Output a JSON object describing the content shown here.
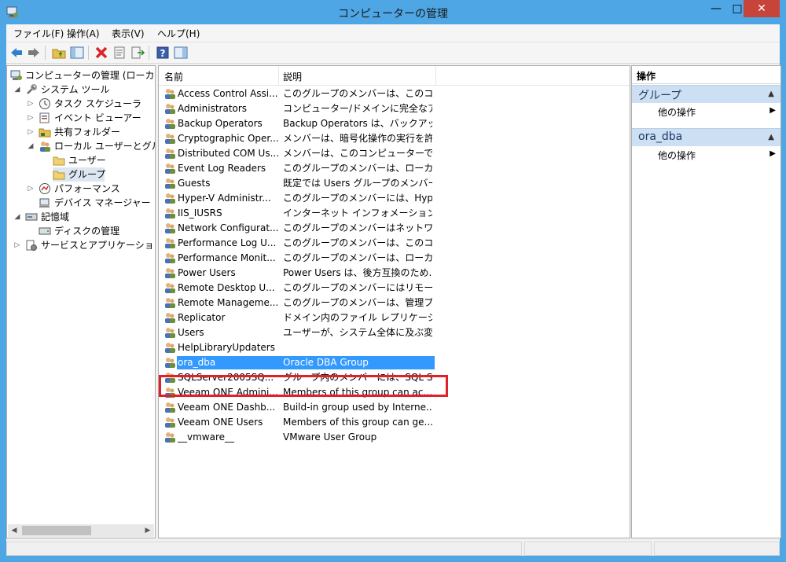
{
  "window": {
    "title": "コンピューターの管理",
    "min": "—",
    "max": "□",
    "close": "✕"
  },
  "menu": [
    "ファイル(F)",
    "操作(A)",
    "表示(V)",
    "ヘルプ(H)"
  ],
  "tree": {
    "items": [
      {
        "label": "コンピューターの管理 (ローカル)",
        "icon": "computer-management-icon"
      },
      {
        "label": "システム ツール",
        "icon": "tools-icon",
        "arrow": "◢"
      },
      {
        "label": "タスク スケジューラ",
        "icon": "clock-icon",
        "arrow": "▷"
      },
      {
        "label": "イベント ビューアー",
        "icon": "event-viewer-icon",
        "arrow": "▷"
      },
      {
        "label": "共有フォルダー",
        "icon": "shared-folder-icon",
        "arrow": "▷"
      },
      {
        "label": "ローカル ユーザーとグループ",
        "icon": "users-icon",
        "arrow": "◢"
      },
      {
        "label": "ユーザー",
        "icon": "folder-icon"
      },
      {
        "label": "グループ",
        "icon": "folder-icon"
      },
      {
        "label": "パフォーマンス",
        "icon": "performance-icon",
        "arrow": "▷"
      },
      {
        "label": "デバイス マネージャー",
        "icon": "device-manager-icon"
      },
      {
        "label": "記憶域",
        "icon": "storage-icon",
        "arrow": "◢"
      },
      {
        "label": "ディスクの管理",
        "icon": "disk-icon"
      },
      {
        "label": "サービスとアプリケーション",
        "icon": "services-icon",
        "arrow": "▷"
      }
    ]
  },
  "list": {
    "headers": {
      "name": "名前",
      "description": "説明"
    },
    "rows": [
      {
        "name": "Access Control Assi...",
        "description": "このグループのメンバーは、このコンピュ..."
      },
      {
        "name": "Administrators",
        "description": "コンピューター/ドメインに完全なアクセ..."
      },
      {
        "name": "Backup Operators",
        "description": "Backup Operators は、バックアップ..."
      },
      {
        "name": "Cryptographic Oper...",
        "description": "メンバーは、暗号化操作の実行を許..."
      },
      {
        "name": "Distributed COM Us...",
        "description": "メンバーは、このコンピューターで分散 ..."
      },
      {
        "name": "Event Log Readers",
        "description": "このグループのメンバーは、ローカル コ..."
      },
      {
        "name": "Guests",
        "description": "既定では Users グループのメンバー..."
      },
      {
        "name": "Hyper-V Administr...",
        "description": "このグループのメンバーには、Hyper-..."
      },
      {
        "name": "IIS_IUSRS",
        "description": "インターネット インフォメーション サービ..."
      },
      {
        "name": "Network Configurat...",
        "description": "このグループのメンバーはネットワーク..."
      },
      {
        "name": "Performance Log U...",
        "description": "このグループのメンバーは、このコンピュ..."
      },
      {
        "name": "Performance Monit...",
        "description": "このグループのメンバーは、ローカルやリ..."
      },
      {
        "name": "Power Users",
        "description": "Power Users は、後方互換のため..."
      },
      {
        "name": "Remote Desktop U...",
        "description": "このグループのメンバーにはリモートから..."
      },
      {
        "name": "Remote Manageme...",
        "description": "このグループのメンバーは、管理プロト..."
      },
      {
        "name": "Replicator",
        "description": "ドメイン内のファイル レプリケーションを..."
      },
      {
        "name": "Users",
        "description": "ユーザーが、システム全体に及ぶ変更..."
      },
      {
        "name": "HelpLibraryUpdaters",
        "description": ""
      },
      {
        "name": "ora_dba",
        "description": "Oracle DBA Group"
      },
      {
        "name": "SQLServer2005SQ...",
        "description": "グループ内のメンバーには、SQL Ser..."
      },
      {
        "name": "Veeam ONE Admini...",
        "description": "Members of this group can ac..."
      },
      {
        "name": "Veeam ONE Dashb...",
        "description": "Build-in group used by Interne..."
      },
      {
        "name": "Veeam ONE Users",
        "description": "Members of this group can ge..."
      },
      {
        "name": "__vmware__",
        "description": "VMware User Group"
      }
    ]
  },
  "actions": {
    "header": "操作",
    "sections": [
      {
        "title": "グループ",
        "item": "他の操作"
      },
      {
        "title": "ora_dba",
        "item": "他の操作"
      }
    ]
  },
  "colors": {
    "highlight_box": "#e32028",
    "selection": "#3399ff",
    "section_bg": "#cddff3"
  }
}
